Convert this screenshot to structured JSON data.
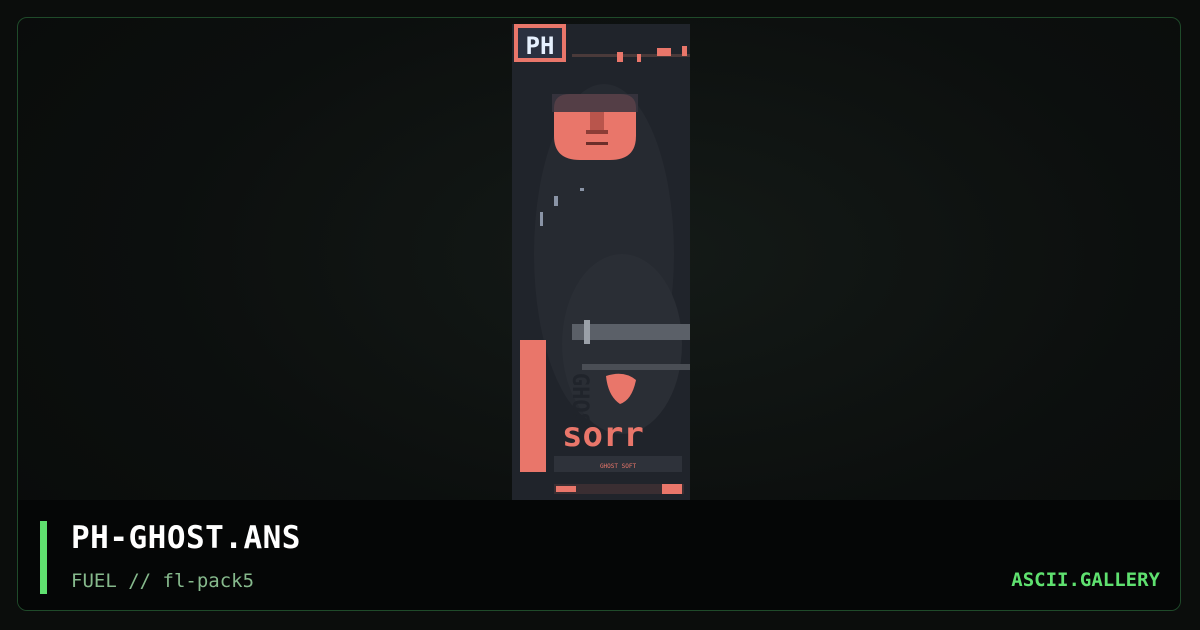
{
  "artwork": {
    "title": "PH-GHOST.ANS",
    "byline": "FUEL // fl-pack5",
    "icon": "ansi-artwork-thumbnail",
    "logo_text": "PH",
    "side_text": "GHOST",
    "main_text": "sorr",
    "footer_text": "GHOST SOFT"
  },
  "site": {
    "brand": "ASCII.GALLERY"
  },
  "colors": {
    "accent": "#5fe06f",
    "artwork_salmon": "#e9766a",
    "artwork_bg": "#20242b",
    "card_border": "#1f4a2a",
    "caption_bg": "#050606",
    "byline": "#86b98c"
  }
}
